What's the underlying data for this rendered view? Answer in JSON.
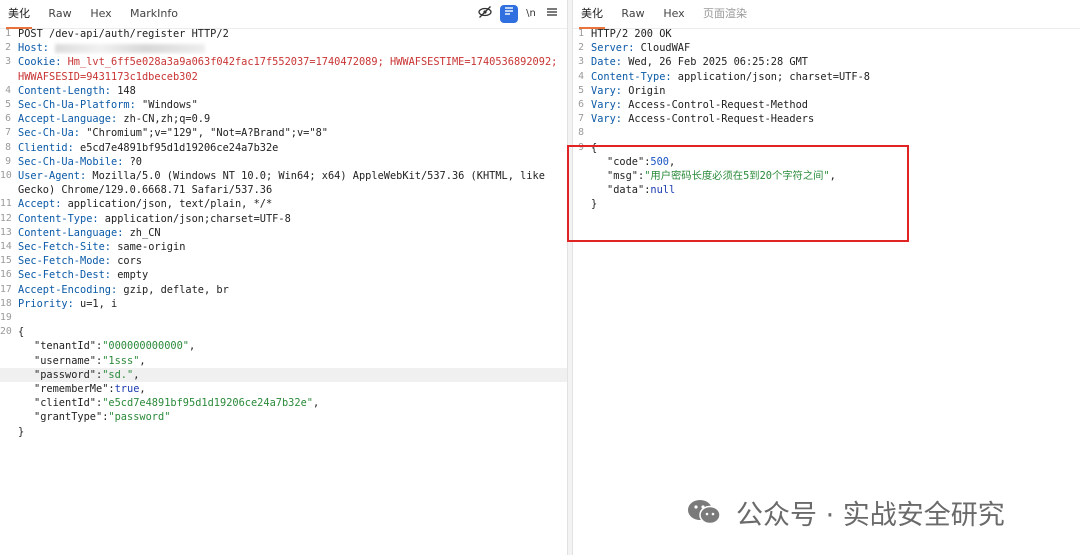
{
  "request": {
    "tabs": [
      "美化",
      "Raw",
      "Hex",
      "MarkInfo"
    ],
    "tools": {
      "eye_slash": "⊘",
      "wrap": "☰",
      "newline": "\\n",
      "menu": "≡"
    },
    "lines": [
      {
        "n": "1",
        "t": "POST /dev-api/auth/register HTTP/2"
      },
      {
        "n": "2",
        "k": "Host:",
        "v": " "
      },
      {
        "n": "3",
        "k": "Cookie:",
        "v": " Hm_lvt_6ff5e028a3a9a063f042fac17f552037=1740472089; HWWAFSESTIME=1740536892092;"
      },
      {
        "n": "",
        "t": "HWWAFSESID=9431173c1dbeceb302"
      },
      {
        "n": "4",
        "k": "Content-Length:",
        "v": " 148"
      },
      {
        "n": "5",
        "k": "Sec-Ch-Ua-Platform:",
        "v": " \"Windows\""
      },
      {
        "n": "6",
        "k": "Accept-Language:",
        "v": " zh-CN,zh;q=0.9"
      },
      {
        "n": "7",
        "k": "Sec-Ch-Ua:",
        "v": " \"Chromium\";v=\"129\", \"Not=A?Brand\";v=\"8\""
      },
      {
        "n": "8",
        "k": "Clientid:",
        "v": " e5cd7e4891bf95d1d19206ce24a7b32e"
      },
      {
        "n": "9",
        "k": "Sec-Ch-Ua-Mobile:",
        "v": " ?0"
      },
      {
        "n": "10",
        "k": "User-Agent:",
        "v": " Mozilla/5.0 (Windows NT 10.0; Win64; x64) AppleWebKit/537.36 (KHTML, like"
      },
      {
        "n": "",
        "t": "Gecko) Chrome/129.0.6668.71 Safari/537.36"
      },
      {
        "n": "11",
        "k": "Accept:",
        "v": " application/json, text/plain, */*"
      },
      {
        "n": "12",
        "k": "Content-Type:",
        "v": " application/json;charset=UTF-8"
      },
      {
        "n": "13",
        "k": "Content-Language:",
        "v": " zh_CN"
      },
      {
        "n": "14",
        "k": "Sec-Fetch-Site:",
        "v": " same-origin"
      },
      {
        "n": "15",
        "k": "Sec-Fetch-Mode:",
        "v": " cors"
      },
      {
        "n": "16",
        "k": "Sec-Fetch-Dest:",
        "v": " empty"
      },
      {
        "n": "17",
        "k": "Accept-Encoding:",
        "v": " gzip, deflate, br"
      },
      {
        "n": "18",
        "k": "Priority:",
        "v": " u=1, i"
      },
      {
        "n": "19",
        "t": ""
      },
      {
        "n": "20",
        "t": "{"
      },
      {
        "n": "",
        "jk": "\"tenantId\"",
        "jv": "\"000000000000\"",
        "jt": "s",
        "c": ","
      },
      {
        "n": "",
        "jk": "\"username\"",
        "jv": "\"1sss\"",
        "jt": "s",
        "c": ","
      },
      {
        "n": "",
        "jk": "\"password\"",
        "jv": "\"sd.\"",
        "jt": "s",
        "c": ",",
        "hl": true
      },
      {
        "n": "",
        "jk": "\"rememberMe\"",
        "jv": "true",
        "jt": "k",
        "c": ","
      },
      {
        "n": "",
        "jk": "\"clientId\"",
        "jv": "\"e5cd7e4891bf95d1d19206ce24a7b32e\"",
        "jt": "s",
        "c": ","
      },
      {
        "n": "",
        "jk": "\"grantType\"",
        "jv": "\"password\"",
        "jt": "s",
        "c": ""
      },
      {
        "n": "",
        "t": "}"
      }
    ]
  },
  "response": {
    "tabs": [
      "美化",
      "Raw",
      "Hex",
      "页面渲染"
    ],
    "lines": [
      {
        "n": "1",
        "t": "HTTP/2 200 OK"
      },
      {
        "n": "2",
        "k": "Server:",
        "v": " CloudWAF"
      },
      {
        "n": "3",
        "k": "Date:",
        "v": " Wed, 26 Feb 2025 06:25:28 GMT"
      },
      {
        "n": "4",
        "k": "Content-Type:",
        "v": " application/json; charset=UTF-8"
      },
      {
        "n": "5",
        "k": "Vary:",
        "v": " Origin"
      },
      {
        "n": "6",
        "k": "Vary:",
        "v": " Access-Control-Request-Method"
      },
      {
        "n": "7",
        "k": "Vary:",
        "v": " Access-Control-Request-Headers"
      },
      {
        "n": "8",
        "t": ""
      },
      {
        "n": "9",
        "t": "{"
      },
      {
        "n": "",
        "jk": "\"code\"",
        "jv": "500",
        "jt": "n",
        "c": ","
      },
      {
        "n": "",
        "jk": "\"msg\"",
        "jv": "\"用户密码长度必须在5到20个字符之间\"",
        "jt": "s",
        "c": ","
      },
      {
        "n": "",
        "jk": "\"data\"",
        "jv": "null",
        "jt": "k",
        "c": ""
      },
      {
        "n": "",
        "t": "}"
      }
    ]
  },
  "watermark": {
    "text": "公众号 · 实战安全研究",
    "icon": "wechat-icon"
  }
}
